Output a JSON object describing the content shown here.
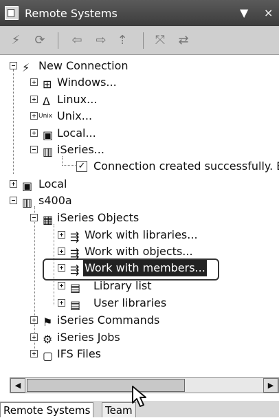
{
  "view": {
    "title": "Remote Systems",
    "menu_glyph": "▼",
    "close_glyph": "×"
  },
  "toolbar": {
    "icons": [
      "new-connection-icon",
      "refresh-icon",
      "back-icon",
      "forward-icon",
      "up-icon",
      "collapse-all-icon",
      "link-icon"
    ]
  },
  "tree": {
    "new_connection": "New Connection",
    "windows": "Windows...",
    "linux": "Linux...",
    "unix": "Unix...",
    "unix_prefix": "Unix",
    "local_new": "Local...",
    "iseries_new": "iSeries...",
    "connection_created": "Connection created successfully. Exp",
    "local": "Local",
    "s400a": "s400a",
    "iseries_objects": "iSeries Objects",
    "work_libraries": "Work with libraries...",
    "work_objects": "Work with objects...",
    "work_members": "Work with members...",
    "library_list": "Library list",
    "user_libraries": "User libraries",
    "iseries_commands": "iSeries Commands",
    "iseries_jobs": "iSeries Jobs",
    "ifs_files": "IFS Files"
  },
  "tabs": {
    "remote_systems": "Remote Systems",
    "team": "Team"
  }
}
